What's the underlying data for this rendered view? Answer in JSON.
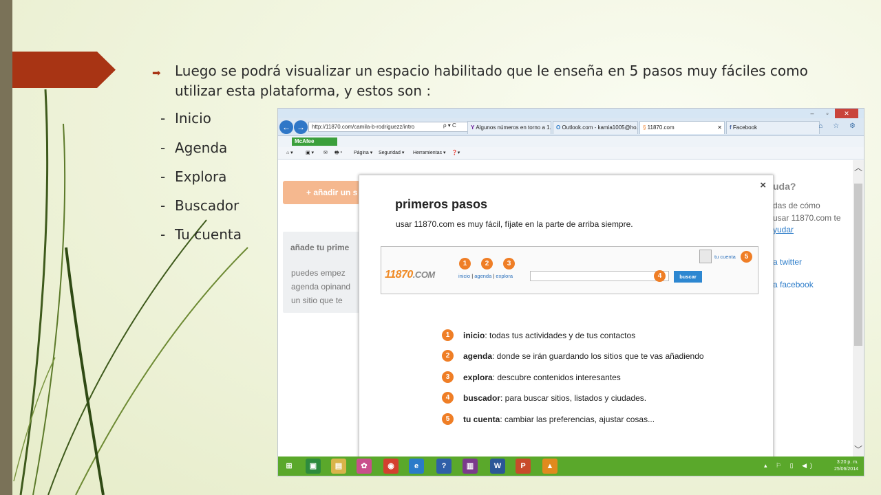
{
  "slide": {
    "bullet_text": "Luego se podrá visualizar un espacio habilitado que le enseña en 5 pasos muy fáciles  como utilizar esta plataforma, y estos son :",
    "items": [
      "Inicio",
      "Agenda",
      "Explora",
      "Buscador",
      "Tu cuenta"
    ],
    "colors": {
      "accent": "#a83414",
      "background": "#f1f5df",
      "sidebar": "#7a7258"
    }
  },
  "browser": {
    "window_controls": {
      "minimize": "‒",
      "maximize": "▫",
      "close": "✕"
    },
    "address": "http://11870.com/camila-b-rodriguezz/intro",
    "address_controls": "ρ ▾ C",
    "tabs": [
      {
        "label": "Algunos números en torno a 1...",
        "icon": "yahoo-icon"
      },
      {
        "label": "Outlook.com - kamia1005@ho...",
        "icon": "outlook-icon"
      },
      {
        "label": "11870.com",
        "icon": "site-icon",
        "close": "✕"
      },
      {
        "label": "Facebook",
        "icon": "facebook-icon"
      }
    ],
    "toolbar_right_icons": "⌂ ☆ ⚙",
    "mcafee_label": "McAfee",
    "commands": {
      "home": "⌂ ▾",
      "feeds": "▣ ▾",
      "mail": "✉",
      "print": "🖶 ▾",
      "pagina": "Página ▾",
      "seguridad": "Seguridad ▾",
      "herramientas": "Herramientas ▾",
      "help": "❓▾"
    }
  },
  "page": {
    "add_button": "+ añadir un s",
    "side_box": {
      "heading": "añade tu prime",
      "lines": [
        "puedes empez",
        "agenda opinand",
        "un sitio que te"
      ]
    },
    "help": {
      "title": "uda?",
      "text": [
        "das de cómo",
        "usar 11870.com te"
      ],
      "link_ayudar": "yudar",
      "link_twitter": "a twitter",
      "link_facebook": "a facebook"
    },
    "scroll": {
      "up": "︿",
      "down": "﹀"
    }
  },
  "modal": {
    "close": "×",
    "title": "primeros pasos",
    "subtitle": "usar 11870.com es muy fácil, fíjate en la parte de arriba siempre.",
    "preview": {
      "logo_main": "11870",
      "logo_com": ".COM",
      "nav_inicio": "inicio",
      "nav_agenda": "agenda",
      "nav_explora": "explora",
      "nav_sep": "|",
      "search_button": "buscar",
      "account_link": "tu cuenta",
      "numbers": [
        "1",
        "2",
        "3",
        "4",
        "5"
      ]
    },
    "steps": [
      {
        "num": "1",
        "term": "inicio",
        "desc": ": todas tus actividades y de tus contactos"
      },
      {
        "num": "2",
        "term": "agenda",
        "desc": ": donde se irán guardando los sitios que te vas añadiendo"
      },
      {
        "num": "3",
        "term": "explora",
        "desc": ": descubre contenidos interesantes"
      },
      {
        "num": "4",
        "term": "buscador",
        "desc": ": para buscar sitios, listados y ciudades."
      },
      {
        "num": "5",
        "term": "tu cuenta",
        "desc": ": cambiar las preferencias, ajustar cosas..."
      }
    ]
  },
  "taskbar": {
    "icons": [
      {
        "name": "windows-icon",
        "glyph": "⊞",
        "color": "#5aa82b"
      },
      {
        "name": "store-icon",
        "glyph": "▣",
        "color": "#2e8b3e"
      },
      {
        "name": "file-explorer-icon",
        "glyph": "▤",
        "color": "#d9b44a"
      },
      {
        "name": "pinwheel-icon",
        "glyph": "✿",
        "color": "#c94f8c"
      },
      {
        "name": "chrome-icon",
        "glyph": "◉",
        "color": "#d4402f"
      },
      {
        "name": "internet-explorer-icon",
        "glyph": "e",
        "color": "#2a7bc9"
      },
      {
        "name": "help-icon",
        "glyph": "?",
        "color": "#2f5fa8"
      },
      {
        "name": "winrar-icon",
        "glyph": "▥",
        "color": "#7b3a8c"
      },
      {
        "name": "word-icon",
        "glyph": "W",
        "color": "#2b5797"
      },
      {
        "name": "powerpoint-icon",
        "glyph": "P",
        "color": "#c84b2b"
      },
      {
        "name": "vlc-icon",
        "glyph": "▲",
        "color": "#e08a1e"
      }
    ],
    "tray_icons": "▴ ⚐ ▯ ◀)",
    "time": "3:20 p. m.",
    "date": "25/06/2014"
  }
}
